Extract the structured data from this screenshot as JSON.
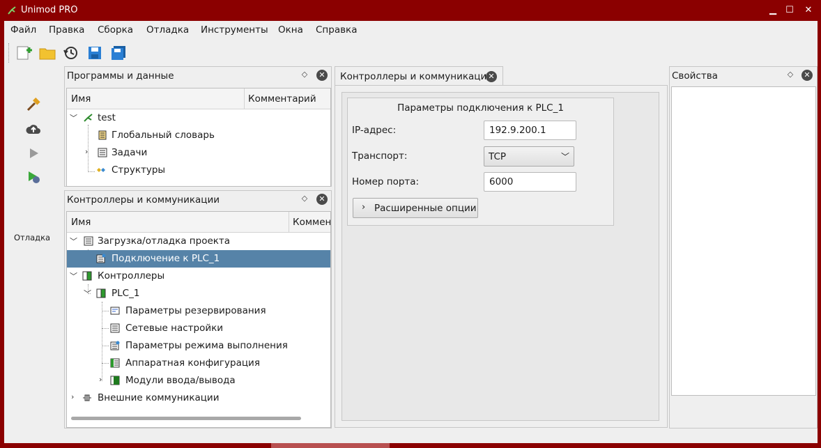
{
  "window": {
    "title": "Unimod PRO"
  },
  "menu": [
    "Файл",
    "Правка",
    "Сборка",
    "Отладка",
    "Инструменты",
    "Окна",
    "Справка"
  ],
  "toolbar": {
    "icons": [
      "new-project-icon",
      "open-folder-icon",
      "history-icon",
      "save-icon",
      "save-all-icon"
    ]
  },
  "left_toolbar": {
    "icons": [
      "build-hammer-icon",
      "upload-cloud-icon",
      "run-play-icon",
      "debug-icon"
    ],
    "debug_label": "Отладка"
  },
  "programs_panel": {
    "title": "Программы и данные",
    "columns": [
      "Имя",
      "Комментарий"
    ],
    "rows": [
      "test",
      "Глобальный словарь",
      "Задачи",
      "Структуры"
    ]
  },
  "controllers_panel": {
    "title": "Контроллеры и коммуникации",
    "columns": [
      "Имя",
      "Коммент"
    ],
    "rows": [
      "Загрузка/отладка проекта",
      "Подключение к PLC_1",
      "Контроллеры",
      "PLC_1",
      "Параметры резервирования",
      "Сетевые настройки",
      "Параметры режима выполнения",
      "Аппаратная конфигурация",
      "Модули ввода/вывода",
      "Внешние коммуникации"
    ]
  },
  "center_tab": {
    "label": "Контроллеры и коммуникации",
    "group_title": "Параметры подключения к PLC_1",
    "ip_label": "IP-адрес:",
    "ip_value": "192.9.200.1",
    "transport_label": "Транспорт:",
    "transport_value": "TCP",
    "port_label": "Номер порта:",
    "port_value": "6000",
    "advanced_button": "Расширенные опции"
  },
  "properties_panel": {
    "title": "Свойства"
  },
  "colors": {
    "frame": "#8b0000",
    "selection": "#5683a8",
    "background": "#efefef"
  }
}
